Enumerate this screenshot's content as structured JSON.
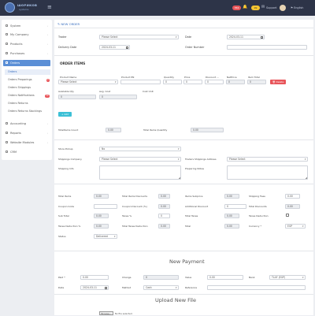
{
  "topbar": {
    "brand": "ШОРИКОВ",
    "brand_sub": "systems",
    "badge_red": "356",
    "badge_yellow": "99",
    "support": "Support",
    "language": "English"
  },
  "sidebar": {
    "items": [
      {
        "label": "System"
      },
      {
        "label": "My Company"
      },
      {
        "label": "Products"
      },
      {
        "label": "Purchases"
      },
      {
        "label": "Orders"
      }
    ],
    "submenu": [
      {
        "label": "Orders"
      },
      {
        "label": "Orders Preparings",
        "badge": "2"
      },
      {
        "label": "Orders Shippings"
      },
      {
        "label": "Orders Notifications",
        "badge": "12"
      },
      {
        "label": "Orders Returns"
      },
      {
        "label": "Orders Returns Stockings"
      }
    ],
    "items_after": [
      {
        "label": "Accounting"
      },
      {
        "label": "Reports"
      },
      {
        "label": "Website Modules"
      },
      {
        "label": "CRM"
      }
    ]
  },
  "header": {
    "title": "NEW ORDER",
    "trader_label": "Trader",
    "trader_value": "Please Select",
    "date_label": "Date",
    "date_value": "2024-03-11",
    "delivery_label": "Delivery Date",
    "delivery_value": "2024-03-11",
    "order_number_label": "Order Number",
    "order_number_value": ""
  },
  "items": {
    "title": "ORDER ITEMS",
    "col_product_name": "Product Name",
    "col_product_pn": "Product PN",
    "col_quantity": "Quantity",
    "col_price": "Price",
    "col_discount": "Discount ...",
    "col_net_price": "NetPrice",
    "col_item_total": "Item Total",
    "product_placeholder": "Please Select",
    "quantity": "0",
    "price": "0",
    "discount": "0",
    "net_price": "0",
    "item_total": "0",
    "delete_label": "Delete",
    "available_label": "Available Qty",
    "available_value": "0",
    "avg_cost_label": "Avg. Cost",
    "avg_cost_value": "0",
    "cost_unit_label": "Cost Unit",
    "add_label": "Add",
    "total_items_count_label": "TotalItems Count",
    "total_items_count_value": "0.00",
    "total_items_quantity_label": "Total Items Quantity",
    "total_items_quantity_value": "0.00"
  },
  "shipping": {
    "store_pickup_label": "Store Pickup",
    "store_pickup_value": "No",
    "shipping_company_label": "Shippings Company",
    "shipping_company_value": "Please Select",
    "traders_address_label": "Traders Shippings Address",
    "traders_address_value": "Please Select",
    "shipping_info_label": "Shipping Info",
    "preparing_notes_label": "Preparing Notes"
  },
  "totals": {
    "total_items_label": "Total Items",
    "total_items_value": "0.00",
    "total_items_discounts_label": "Total Items Discounts",
    "total_items_discounts_value": "0.00",
    "items_subprice_label": "Items Subprice",
    "items_subprice_value": "0.00",
    "shipping_fees_label": "Shipping Fees",
    "shipping_fees_value": "0.00",
    "coupon_code_label": "Coupon Code",
    "coupon_discount_label": "Coupon Discount (%)",
    "coupon_discount_value": "0.00",
    "additional_discount_label": "Additional Discount",
    "additional_discount_value": "0",
    "total_discounts_label": "Total Discounts",
    "total_discounts_value": "0.00",
    "sub_total_label": "Sub Total",
    "sub_total_value": "0.00",
    "taxes_label": "Taxes %",
    "taxes_value": "0",
    "total_taxes_label": "Total Taxes",
    "total_taxes_value": "0.00",
    "taxes_deduction_label": "Taxes Deduction",
    "taxes_deduction_pct_label": "Taxes Deduction %",
    "taxes_deduction_pct_value": "0.00",
    "total_taxes_deduction_label": "Total Taxes Deduction",
    "total_taxes_deduction_value": "0.00",
    "total_label": "Total",
    "total_value": "0.00",
    "currency_label": "Currency *",
    "currency_value": "EGP",
    "status_label": "Status",
    "status_value": "Delivered"
  },
  "payment": {
    "title": "New Payment",
    "paid_label": "Paid *",
    "paid_value": "0.00",
    "change_label": "Change",
    "change_value": "0",
    "value_label": "Value",
    "value_value": "0.00",
    "bank_label": "Bank",
    "bank_value": "TLAF (EGP)",
    "date_label": "Date",
    "date_value": "2024-03-11",
    "method_label": "Method",
    "method_value": "Cash",
    "reference_label": "Reference",
    "reference_value": ""
  },
  "upload": {
    "title": "Upload New File",
    "choose_label": "Browse...",
    "no_file": "No file selected."
  },
  "colors": {
    "topbar": "#2d3448",
    "accent": "#5b8fd6",
    "add_button": "#3cc0d6",
    "delete_button": "#e8555a"
  }
}
